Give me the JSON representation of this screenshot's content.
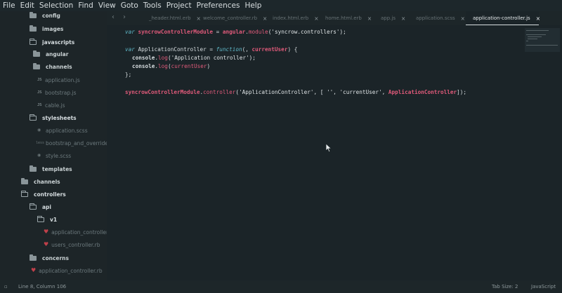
{
  "menu": [
    "File",
    "Edit",
    "Selection",
    "Find",
    "View",
    "Goto",
    "Tools",
    "Project",
    "Preferences",
    "Help"
  ],
  "sidebar": {
    "items": [
      {
        "label": "config",
        "kind": "folder"
      },
      {
        "label": "images",
        "kind": "folder"
      },
      {
        "label": "javascripts",
        "kind": "folder-open"
      },
      {
        "label": "angular",
        "kind": "folder"
      },
      {
        "label": "channels",
        "kind": "folder"
      },
      {
        "label": "application.js",
        "kind": "js"
      },
      {
        "label": "bootstrap.js",
        "kind": "js"
      },
      {
        "label": "cable.js",
        "kind": "js"
      },
      {
        "label": "stylesheets",
        "kind": "folder-open"
      },
      {
        "label": "application.scss",
        "kind": "css"
      },
      {
        "label": "bootstrap_and_overrides.c",
        "kind": "less"
      },
      {
        "label": "style.scss",
        "kind": "css"
      },
      {
        "label": "templates",
        "kind": "folder"
      },
      {
        "label": "channels",
        "kind": "folder"
      },
      {
        "label": "controllers",
        "kind": "folder-open"
      },
      {
        "label": "api",
        "kind": "folder-open"
      },
      {
        "label": "v1",
        "kind": "folder-open"
      },
      {
        "label": "application_controller.rb",
        "kind": "ruby"
      },
      {
        "label": "users_controller.rb",
        "kind": "ruby"
      },
      {
        "label": "concerns",
        "kind": "folder"
      },
      {
        "label": "application_controller.rb",
        "kind": "ruby"
      }
    ]
  },
  "tabs": [
    {
      "label": "_header.html.erb",
      "active": false
    },
    {
      "label": "welcome_controller.rb",
      "active": false
    },
    {
      "label": "index.html.erb",
      "active": false
    },
    {
      "label": "home.html.erb",
      "active": false
    },
    {
      "label": "app.js",
      "active": false
    },
    {
      "label": "application.scss",
      "active": false
    },
    {
      "label": "application-controller.js",
      "active": true
    }
  ],
  "tab_close_glyph": "×",
  "code": {
    "l1": {
      "kw": "var ",
      "name": "syncrowControllerModule",
      "eq": " = ",
      "obj": "angular",
      "dot": ".",
      "method": "module",
      "rest": "('syncrow.controllers');"
    },
    "l3": {
      "kw": "var ",
      "name": "ApplicationController",
      "eq": " = ",
      "fn": "function",
      "p1": "(, ",
      "param": "currentUser",
      "p2": ") {"
    },
    "l4": {
      "obj": "console",
      "dot": ".",
      "method": "log",
      "rest": "('Application controller');"
    },
    "l5": {
      "obj": "console",
      "dot": ".",
      "method": "log",
      "open": "(",
      "param": "currentUser",
      "close": ")"
    },
    "l6": {
      "text": "};"
    },
    "l8": {
      "name": "syncrowControllerModule",
      "dot": ".",
      "method": "controller",
      "rest": "('ApplicationController', [ '', 'currentUser', ",
      "param": "ApplicationController",
      "close": "]);"
    }
  },
  "status": {
    "position": "Line 8, Column 106",
    "tab_size": "Tab Size: 2",
    "syntax": "JavaScript"
  },
  "colors": {
    "accent_red": "#e05a7a",
    "accent_cyan": "#5fb8c8",
    "background": "#1b2428"
  }
}
